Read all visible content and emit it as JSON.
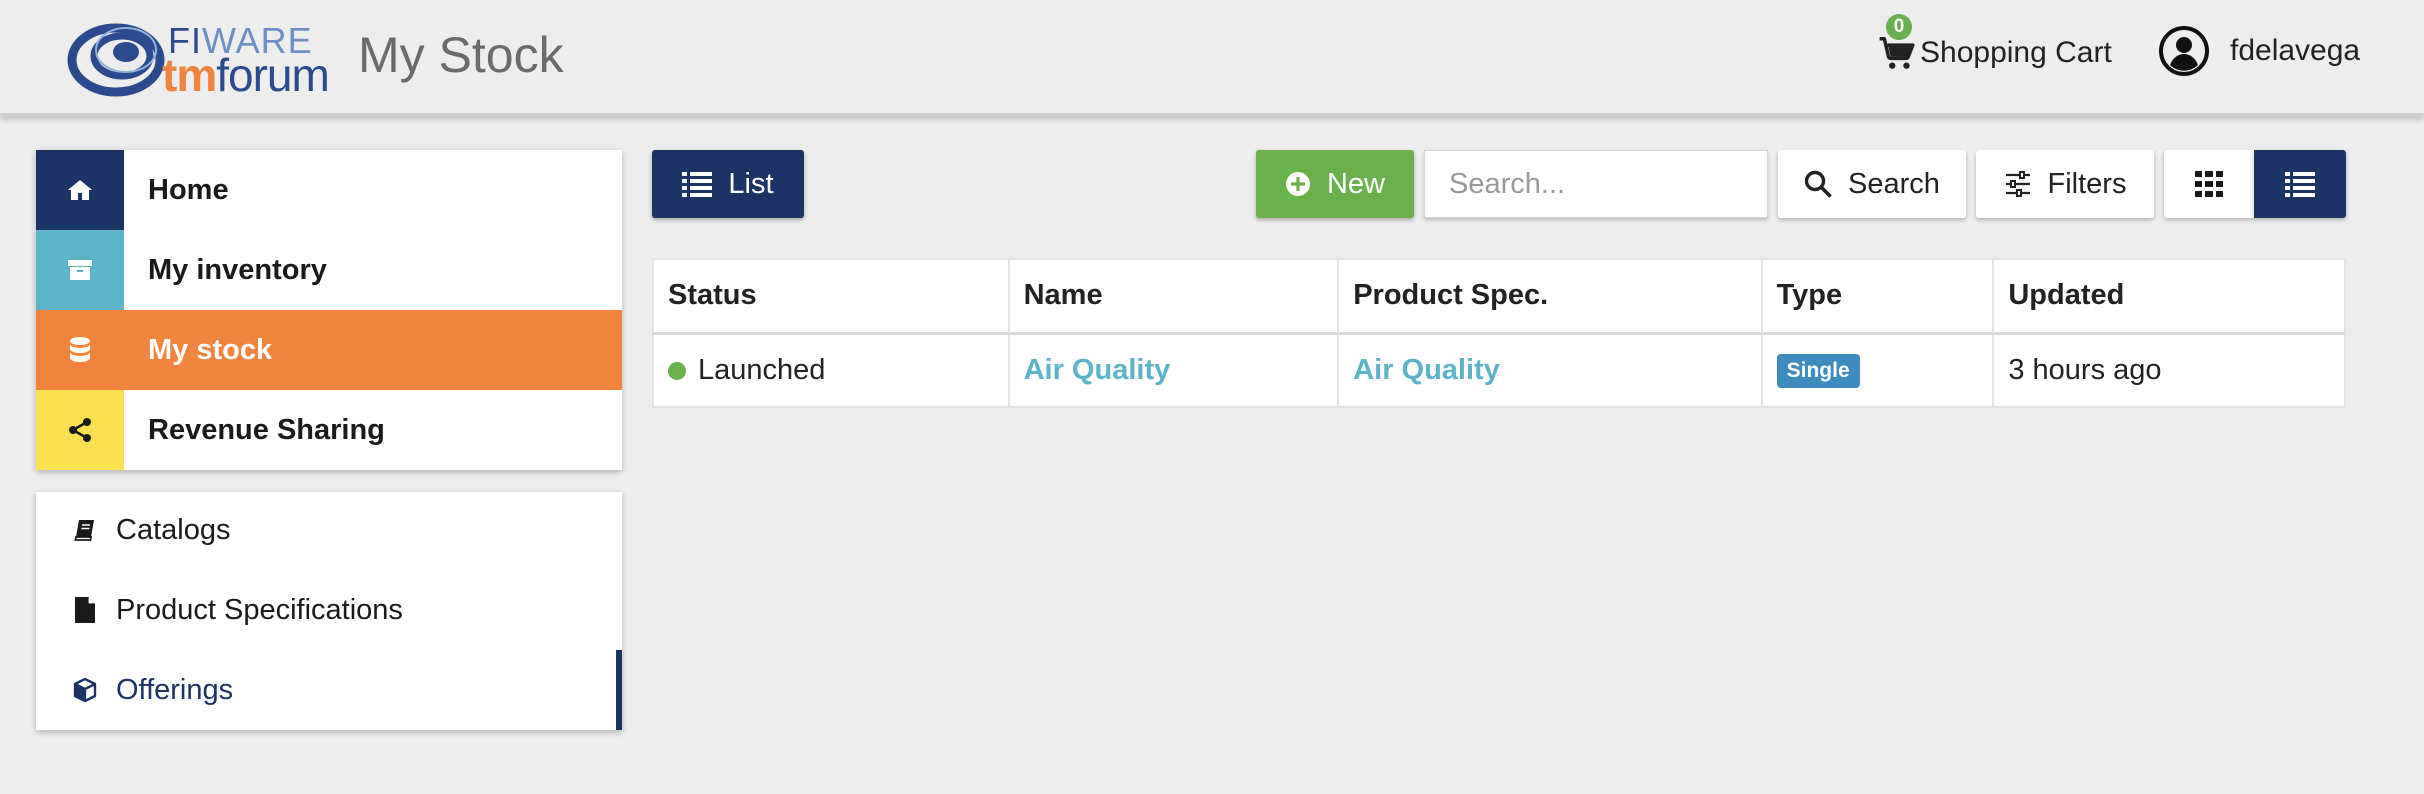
{
  "header": {
    "logo_fi": "FI",
    "logo_ware": "WARE",
    "logo_tm": "tm",
    "logo_forum": "forum",
    "title": "My Stock",
    "cart_count": "0",
    "cart_label": "Shopping Cart",
    "username": "fdelavega"
  },
  "sidebar": {
    "main_items": [
      {
        "label": "Home",
        "icon": "home-icon",
        "color": "#1c3366"
      },
      {
        "label": "My inventory",
        "icon": "archive-icon",
        "color": "#5db4c8"
      },
      {
        "label": "My stock",
        "icon": "database-icon",
        "color": "#f0833e"
      },
      {
        "label": "Revenue Sharing",
        "icon": "share-icon",
        "color": "#fbe04f"
      }
    ],
    "sub_items": [
      {
        "label": "Catalogs",
        "icon": "book-icon"
      },
      {
        "label": "Product Specifications",
        "icon": "file-icon"
      },
      {
        "label": "Offerings",
        "icon": "cube-icon"
      }
    ]
  },
  "toolbar": {
    "list_label": "List",
    "new_label": "New",
    "search_placeholder": "Search...",
    "search_label": "Search",
    "filters_label": "Filters"
  },
  "table": {
    "columns": [
      "Status",
      "Name",
      "Product Spec.",
      "Type",
      "Updated"
    ],
    "rows": [
      {
        "status": "Launched",
        "name": "Air Quality",
        "product_spec": "Air Quality",
        "type": "Single",
        "updated": "3 hours ago"
      }
    ]
  },
  "colors": {
    "primary": "#1c3366",
    "accent_orange": "#f0833e",
    "accent_teal": "#5db4c8",
    "accent_yellow": "#fbe04f",
    "success": "#6ab04c",
    "badge": "#3e8cbf"
  }
}
